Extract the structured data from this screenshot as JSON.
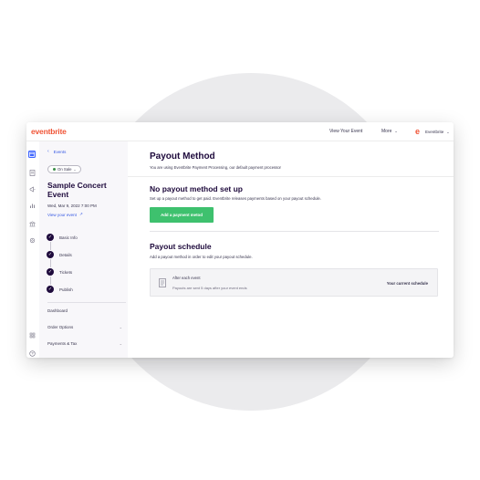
{
  "header": {
    "logo": "eventbrite",
    "view_event": "View Your Event",
    "more": "More",
    "org_logo_letter": "e",
    "org_name": "Eventbrite"
  },
  "sidebar": {
    "back_label": "Events",
    "status": "On Sale",
    "event_title": "Sample Concert Event",
    "event_date": "Wed, Mar 9, 2022 7:00 PM",
    "view_event_link": "View your event",
    "steps": [
      "Basic Info",
      "Details",
      "Tickets",
      "Publish"
    ],
    "links": [
      "Dashboard",
      "Order Options",
      "Payments & Tax"
    ]
  },
  "main": {
    "title": "Payout Method",
    "subtitle": "You are using Eventbrite Payment Processing, our default payment processor",
    "no_payout_heading": "No payout method set up",
    "no_payout_text": "Set up a payout method to get paid. Eventbrite releases payments based on your payout schedule.",
    "add_button": "Add a payment metod",
    "schedule_heading": "Payout schedule",
    "schedule_text": "Add a payout method in order to edit your payout schedule.",
    "schedule_card": {
      "title": "After each event",
      "description": "Payouts are sent 5 days after your event ends",
      "current": "Your current schedule"
    }
  },
  "colors": {
    "brand": "#f05537",
    "primary_button": "#3ec16e",
    "active_rail": "#3d64ff",
    "link": "#3659e3",
    "heading": "#1e0a3c"
  }
}
